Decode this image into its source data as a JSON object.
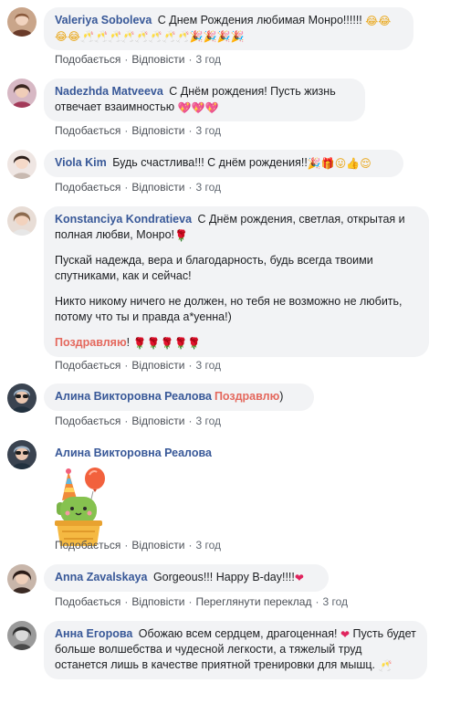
{
  "actions": {
    "like": "Подобається",
    "reply": "Відповісти",
    "translate": "Переглянути переклад",
    "separator": "·"
  },
  "icons": {
    "laugh": "😂",
    "champagne": "🥂",
    "party": "🎉",
    "hearts": "💖",
    "rose": "🌹",
    "gift": "🎁",
    "tongue": "😛",
    "thumbs": "👍",
    "relieved": "😌",
    "heart": "❤"
  },
  "colors": {
    "author": "#385898",
    "bubble": "#f2f3f5",
    "action": "#606770",
    "congrats": "#e4685d"
  },
  "comments": [
    {
      "author": "Valeriya Soboleva",
      "text": "С Днем Рождения любимая Монро!!!!!!",
      "emoji_after": [
        "laugh",
        "laugh",
        "laugh",
        "laugh",
        "champagne",
        "champagne",
        "champagne",
        "champagne",
        "champagne",
        "champagne",
        "champagne",
        "champagne",
        "party",
        "party",
        "party",
        "party"
      ],
      "time": "3 год"
    },
    {
      "author": "Nadezhda Matveeva",
      "text": "С Днём рождения! Пусть жизнь отвечает взаимностью",
      "emoji_after": [
        "hearts",
        "hearts",
        "hearts"
      ],
      "time": "3 год"
    },
    {
      "author": "Viola Kim",
      "text": "Будь счастлива!!! С днём рождения!!",
      "emoji_after": [
        "party",
        "gift",
        "tongue",
        "thumbs",
        "relieved"
      ],
      "time": "3 год"
    },
    {
      "author": "Konstanciya Kondratieva",
      "text": "С Днём рождения, светлая, открытая и полная любви, Монро!",
      "emoji_after": [
        "rose"
      ],
      "para2": "Пускай надежда, вера и благодарность, будь всегда твоими спутниками, как и сейчас!",
      "para3": "Никто никому ничего не должен, но тебя не возможно не любить, потому что ты и правда а*уенна!)",
      "congrats": "Поздравляю",
      "congrats_tail": "!",
      "emoji_final": [
        "rose",
        "rose",
        "rose",
        "rose",
        "rose"
      ],
      "time": "3 год"
    },
    {
      "author": "Алина Викторовна Реалова",
      "congrats": "Поздравлю",
      "tail": ")",
      "time": "3 год"
    },
    {
      "author": "Алина Викторовна Реалова",
      "sticker": "cactus-party-sticker",
      "time": "3 год"
    },
    {
      "author": "Anna Zavalskaya",
      "text": "Gorgeous!!! Happy B-day!!!!",
      "emoji_after": [
        "heart"
      ],
      "time": "3 год"
    },
    {
      "author": "Анна Егорова",
      "text": "Обожаю всем сердцем, драгоценная!",
      "emoji_mid": [
        "heart"
      ],
      "text2": "Пусть будет больше волшебства и чудесной легкости, а тяжелый труд останется лишь в качестве приятной тренировки для мышц.",
      "emoji_after": [
        "champagne"
      ]
    }
  ]
}
